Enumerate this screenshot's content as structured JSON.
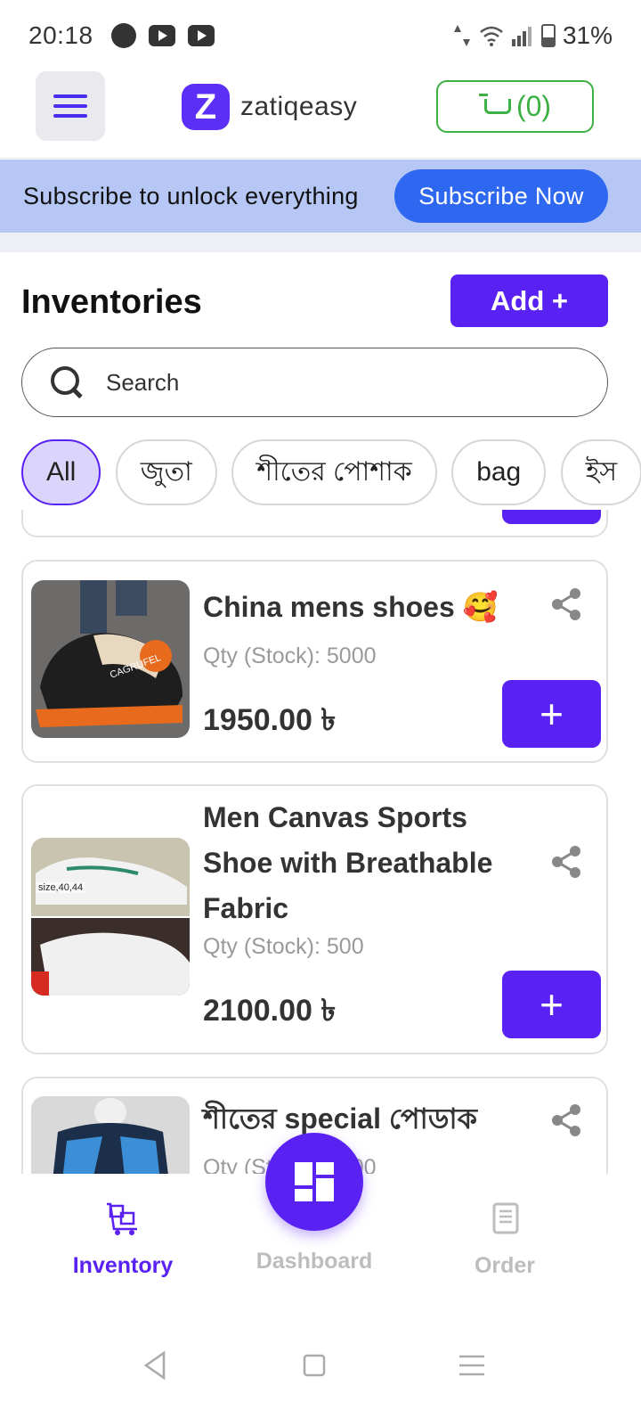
{
  "status_bar": {
    "time": "20:18",
    "battery": "31%",
    "app_icons": [
      "messenger-icon",
      "youtube-icon",
      "youtube-icon"
    ]
  },
  "header": {
    "logo_letter": "Z",
    "logo_text": "zatiqeasy",
    "cart_count": "(0)"
  },
  "banner": {
    "text": "Subscribe to unlock everything",
    "button": "Subscribe Now"
  },
  "inventory": {
    "title": "Inventories",
    "add_label": "Add +",
    "search_placeholder": "Search",
    "categories": [
      "All",
      "জুতা",
      "শীতের পোশাক",
      "bag",
      "ইস"
    ],
    "active_category": "All"
  },
  "products": [
    {
      "name": "China mens shoes 🥰",
      "qty_label": "Qty (Stock): 5000",
      "price": "1950.00 ৳",
      "add_label": "+"
    },
    {
      "name": "Men Canvas Sports Shoe with Breathable Fabric",
      "qty_label": "Qty (Stock): 500",
      "price": "2100.00 ৳",
      "add_label": "+",
      "image_caption": "size,40,44"
    },
    {
      "name": "শীতের special পোডাক",
      "qty_label": "Qty (Stock): 5000"
    }
  ],
  "bottom_nav": {
    "items": [
      {
        "label": "Inventory",
        "icon": "inventory-icon",
        "active": true
      },
      {
        "label": "Dashboard",
        "icon": "dashboard-icon",
        "active": false
      },
      {
        "label": "Order",
        "icon": "order-icon",
        "active": false
      }
    ]
  },
  "colors": {
    "primary": "#5a22f2",
    "subscribe_bg": "#b6c7f5",
    "subscribe_btn": "#2f68f0",
    "cart_green": "#3cb043"
  }
}
